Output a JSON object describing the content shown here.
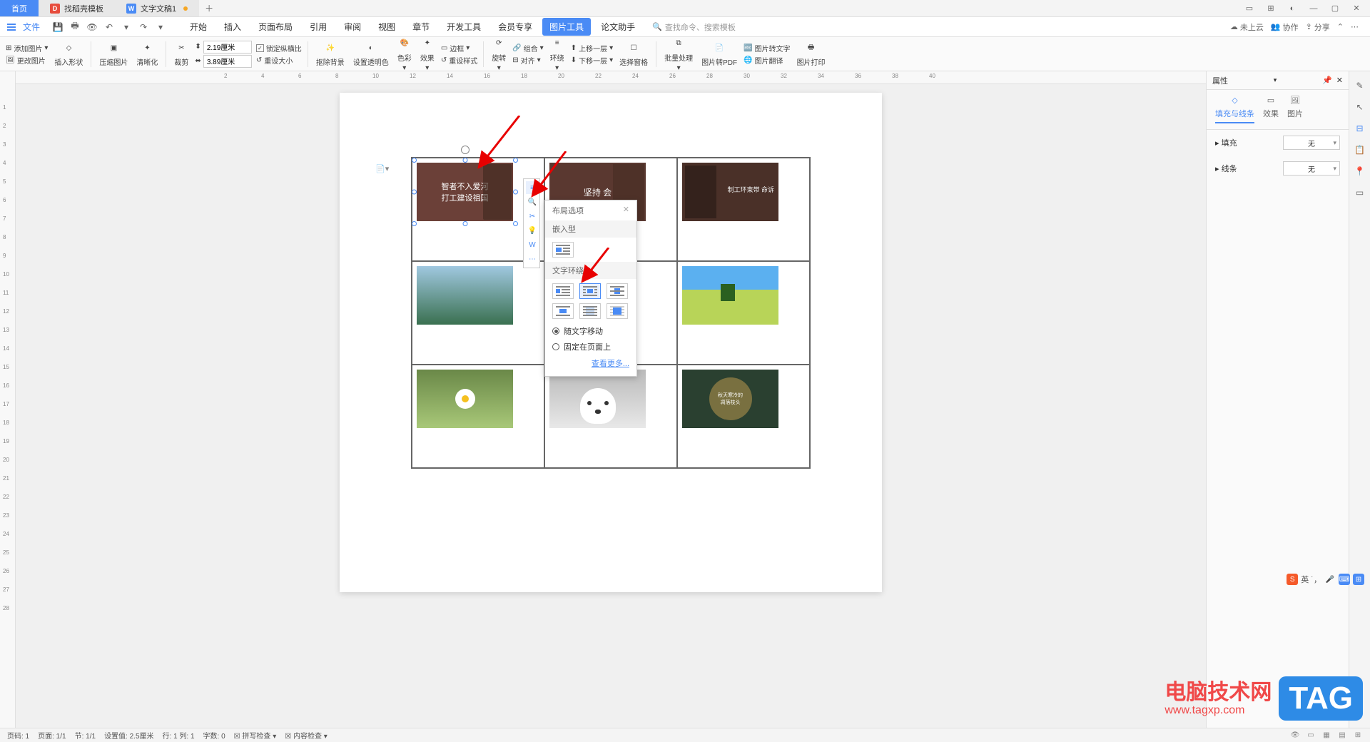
{
  "titlebar": {
    "tabs": [
      {
        "label": "首页",
        "active": true
      },
      {
        "label": "找稻壳模板",
        "icon": "red"
      },
      {
        "label": "文字文稿1",
        "icon": "blue",
        "dot": true
      }
    ]
  },
  "menubar": {
    "file": "文件",
    "tabs": [
      "开始",
      "插入",
      "页面布局",
      "引用",
      "审阅",
      "视图",
      "章节",
      "开发工具",
      "会员专享",
      "图片工具",
      "论文助手"
    ],
    "highlighted_index": 9,
    "search_placeholder": "查找命令、搜索模板",
    "right": {
      "cloud": "未上云",
      "collab": "协作",
      "share": "分享"
    }
  },
  "ribbon": {
    "add_image": "添加图片",
    "change_image": "更改图片",
    "insert_shape": "插入形状",
    "compress": "压缩图片",
    "sharpen": "清晰化",
    "crop": "裁剪",
    "width": "2.19厘米",
    "height": "3.89厘米",
    "lock_ratio": "锁定纵横比",
    "reset_size": "重设大小",
    "remove_bg": "抠除背景",
    "transparency": "设置透明色",
    "color": "色彩",
    "effect": "效果",
    "border": "边框",
    "reset_style": "重设样式",
    "rotate": "旋转",
    "align": "对齐",
    "wrap": "环绕",
    "group": "组合",
    "up": "上移一层",
    "down": "下移一层",
    "select_pane": "选择窗格",
    "batch": "批量处理",
    "to_pdf": "图片转PDF",
    "to_text": "图片转文字",
    "translate": "图片翻译",
    "print": "图片打印"
  },
  "layout_popup": {
    "title": "布局选项",
    "section_embed": "嵌入型",
    "section_wrap": "文字环绕",
    "radio_move": "随文字移动",
    "radio_fixed": "固定在页面上",
    "more": "查看更多..."
  },
  "grid_images": {
    "text1_line1": "智者不入爱河",
    "text1_line2": "打工建设祖国",
    "text2": "坚持    会"
  },
  "right_panel": {
    "title": "属性",
    "tabs": {
      "fill": "填充与线条",
      "effect": "效果",
      "image": "图片"
    },
    "fill_label": "填充",
    "fill_value": "无",
    "line_label": "线条",
    "line_value": "无"
  },
  "statusbar": {
    "page": "页码: 1",
    "page_area": "页面: 1/1",
    "section": "节: 1/1",
    "set_value": "设置值: 2.5厘米",
    "rowcol": "行: 1 列: 1",
    "words": "字数: 0",
    "spell": "拼写检查",
    "content": "内容检查"
  },
  "watermark": {
    "text": "电脑技术网",
    "url": "www.tagxp.com",
    "tag": "TAG"
  }
}
